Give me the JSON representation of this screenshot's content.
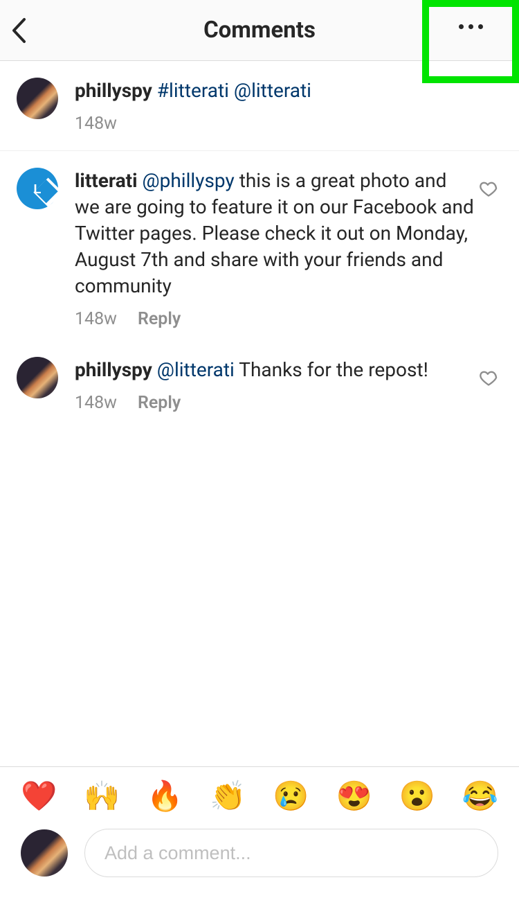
{
  "header": {
    "title": "Comments"
  },
  "op": {
    "username": "phillyspy",
    "caption_hashtag": "#litterati",
    "caption_mention": "@litterati",
    "timestamp": "148w"
  },
  "comments": [
    {
      "username": "litterati",
      "mention": "@phillyspy",
      "text_rest": " this is a great photo and we are going to feature it on our Facebook and Twitter pages. Please check it out on Monday, August 7th and share with your friends and community",
      "timestamp": "148w",
      "reply_label": "Reply"
    },
    {
      "username": "phillyspy",
      "mention": "@litterati",
      "text_rest": " Thanks for the repost!",
      "timestamp": "148w",
      "reply_label": "Reply"
    }
  ],
  "emoji_bar": [
    "❤️",
    "🙌",
    "🔥",
    "👏",
    "😢",
    "😍",
    "😮",
    "😂"
  ],
  "compose": {
    "placeholder": "Add a comment..."
  }
}
